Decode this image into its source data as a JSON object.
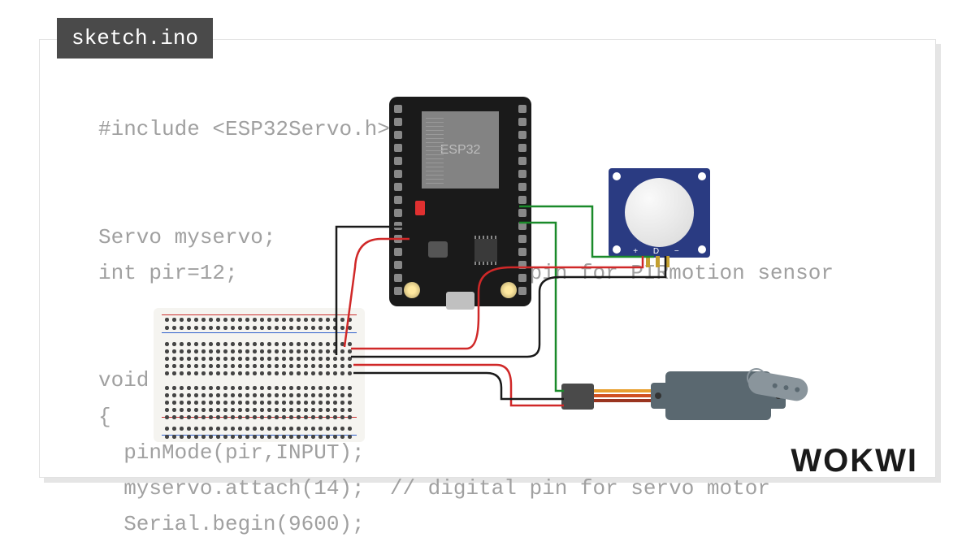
{
  "tab": {
    "filename": "sketch.ino"
  },
  "code": "#include <ESP32Servo.h>\n\n\nServo myservo;\nint pir=12;            // digital pin for PIRmotion sensor\n\n\nvoid setup()\n{\n  pinMode(pir,INPUT);\n  myservo.attach(14);  // digital pin for servo motor\n  Serial.begin(9600);",
  "components": {
    "esp32": {
      "label": "ESP32"
    },
    "pir": {
      "pin_labels": "+ D -"
    },
    "servo": {
      "wires": [
        "#e8a030",
        "#d05020",
        "#9a3520"
      ]
    }
  },
  "wiring": {
    "colors": {
      "vcc": "#d02828",
      "gnd": "#1a1a1a",
      "sig1": "#1a8a2a",
      "sig2": "#1a8a2a"
    }
  },
  "branding": {
    "logo": "WOKWI"
  }
}
